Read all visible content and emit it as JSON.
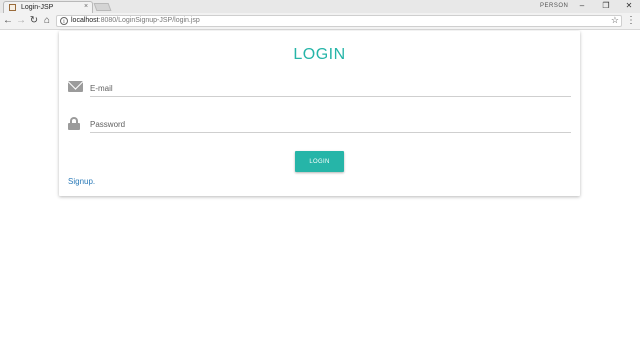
{
  "browser": {
    "tab_title": "Login-JSP",
    "tab_close": "×",
    "profile_label": "PERSON",
    "window_controls": {
      "minimize": "–",
      "restore": "❐",
      "close": "✕"
    },
    "nav": {
      "back": "←",
      "forward": "→",
      "reload": "↻",
      "home": "⌂"
    },
    "url_host": "localhost",
    "url_path": ":8080/LoginSignup-JSP/login.jsp",
    "info_glyph": "i",
    "bookmark_star": "☆",
    "menu": "⋮"
  },
  "page": {
    "title": "LOGIN",
    "email_placeholder": "E-mail",
    "password_placeholder": "Password",
    "login_button": "LOGIN",
    "signup_link": "Signup.",
    "accent_color": "#26b5a8",
    "link_color": "#2a7ab8",
    "icons": [
      "envelope-icon",
      "lock-icon"
    ]
  }
}
